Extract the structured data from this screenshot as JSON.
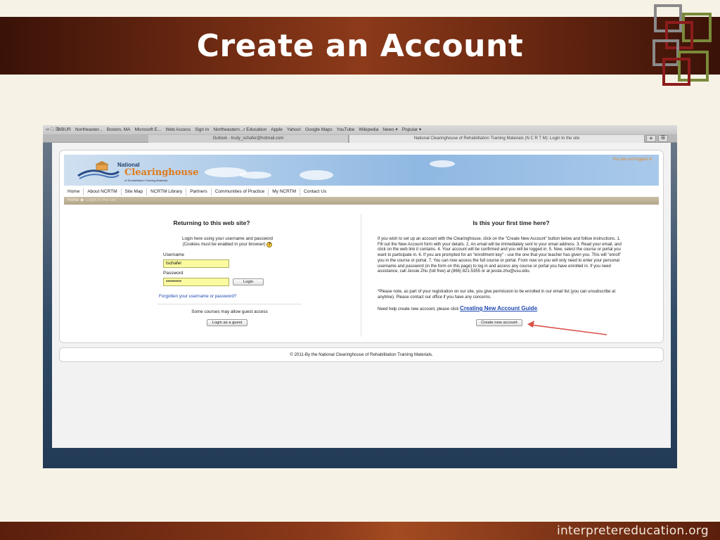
{
  "slide": {
    "title": "Create an Account",
    "footer_url": "interpretereducation.org"
  },
  "browser": {
    "bookmarks": [
      "WBUR",
      "Northeaster...",
      "Boston, MA",
      "Microsoft E...",
      "Web Access",
      "Sign In",
      "Northeastern...r Education",
      "Apple",
      "Yahoo!",
      "Google Maps",
      "YouTube",
      "Wikipedia",
      "News ▾",
      "Popular ▾"
    ],
    "tabs": [
      "Outlook - trudy_schafer@hotmail.com",
      "National Clearinghouse of Rehabilitation Training Materials (N C R T M): Login to the site"
    ],
    "new_tab_label": "+"
  },
  "site": {
    "logo_national": "National",
    "logo_clearinghouse": "Clearinghouse",
    "logo_sub": "of Rehabilitation Training Materials",
    "login_status": "You are not logged in.",
    "nav": [
      "Home",
      "About NCRTM",
      "Site Map",
      "NCRTM Library",
      "Partners",
      "Communities of Practice",
      "My NCRTM",
      "Contact Us"
    ],
    "breadcrumb": {
      "home": "Home",
      "sep": "▶",
      "current": "Login to the site"
    },
    "login": {
      "heading": "Returning to this web site?",
      "info_line1": "Login here using your username and password",
      "info_line2": "(Cookies must be enabled in your browser)",
      "help_symbol": "?",
      "username_label": "Username",
      "username_value": "tschafer",
      "password_label": "Password",
      "password_value": "••••••••••",
      "login_button": "Login",
      "forgot_link": "Forgotten your username or password?",
      "guest_note": "Some courses may allow guest access",
      "guest_button": "Login as a guest"
    },
    "signup": {
      "heading": "Is this your first time here?",
      "instructions": "If you wish to set up an account with the Clearinghouse, click on the \"Create New Account\" button below and follow instructions. 1. Fill out the New Account form with your details. 2. An email will be immediately sent to your email address. 3. Read your email, and click on the web link it contains. 4. Your account will be confirmed and you will be logged in. 5. Now, select the course or portal you want to participate in. 6. If you are prompted for an \"enrollment key\" - use the one that your teacher has given you. This will \"enroll\" you in the course or portal. 7. You can now access the full course or portal. From now on you will only need to enter your personal username and password (in the form on this page) to log in and access any course or portal you have enrolled in. If you need assistance, call Jessie Zhu (toll free) at (866) 821-5355 or at jessie.zhu@usu.edu.",
      "note": "*Please note, as part of your registration on our site, you give permission to be enrolled in our email list (you can unsubscribe at anytime). Please contact our office if you have any concerns.",
      "help_prefix": "Need help create new account, please click",
      "guide_link": "Creating New Account Guide",
      "help_suffix": ".",
      "create_button": "Create new account"
    },
    "footer": "© 2011-By the National Clearinghouse of Rehabilitation Training Materials."
  },
  "colors": {
    "title_bar": "#6e2a12",
    "arrow": "#d9534a",
    "link": "#1c47b0",
    "input_highlight": "#fbfaa0"
  }
}
